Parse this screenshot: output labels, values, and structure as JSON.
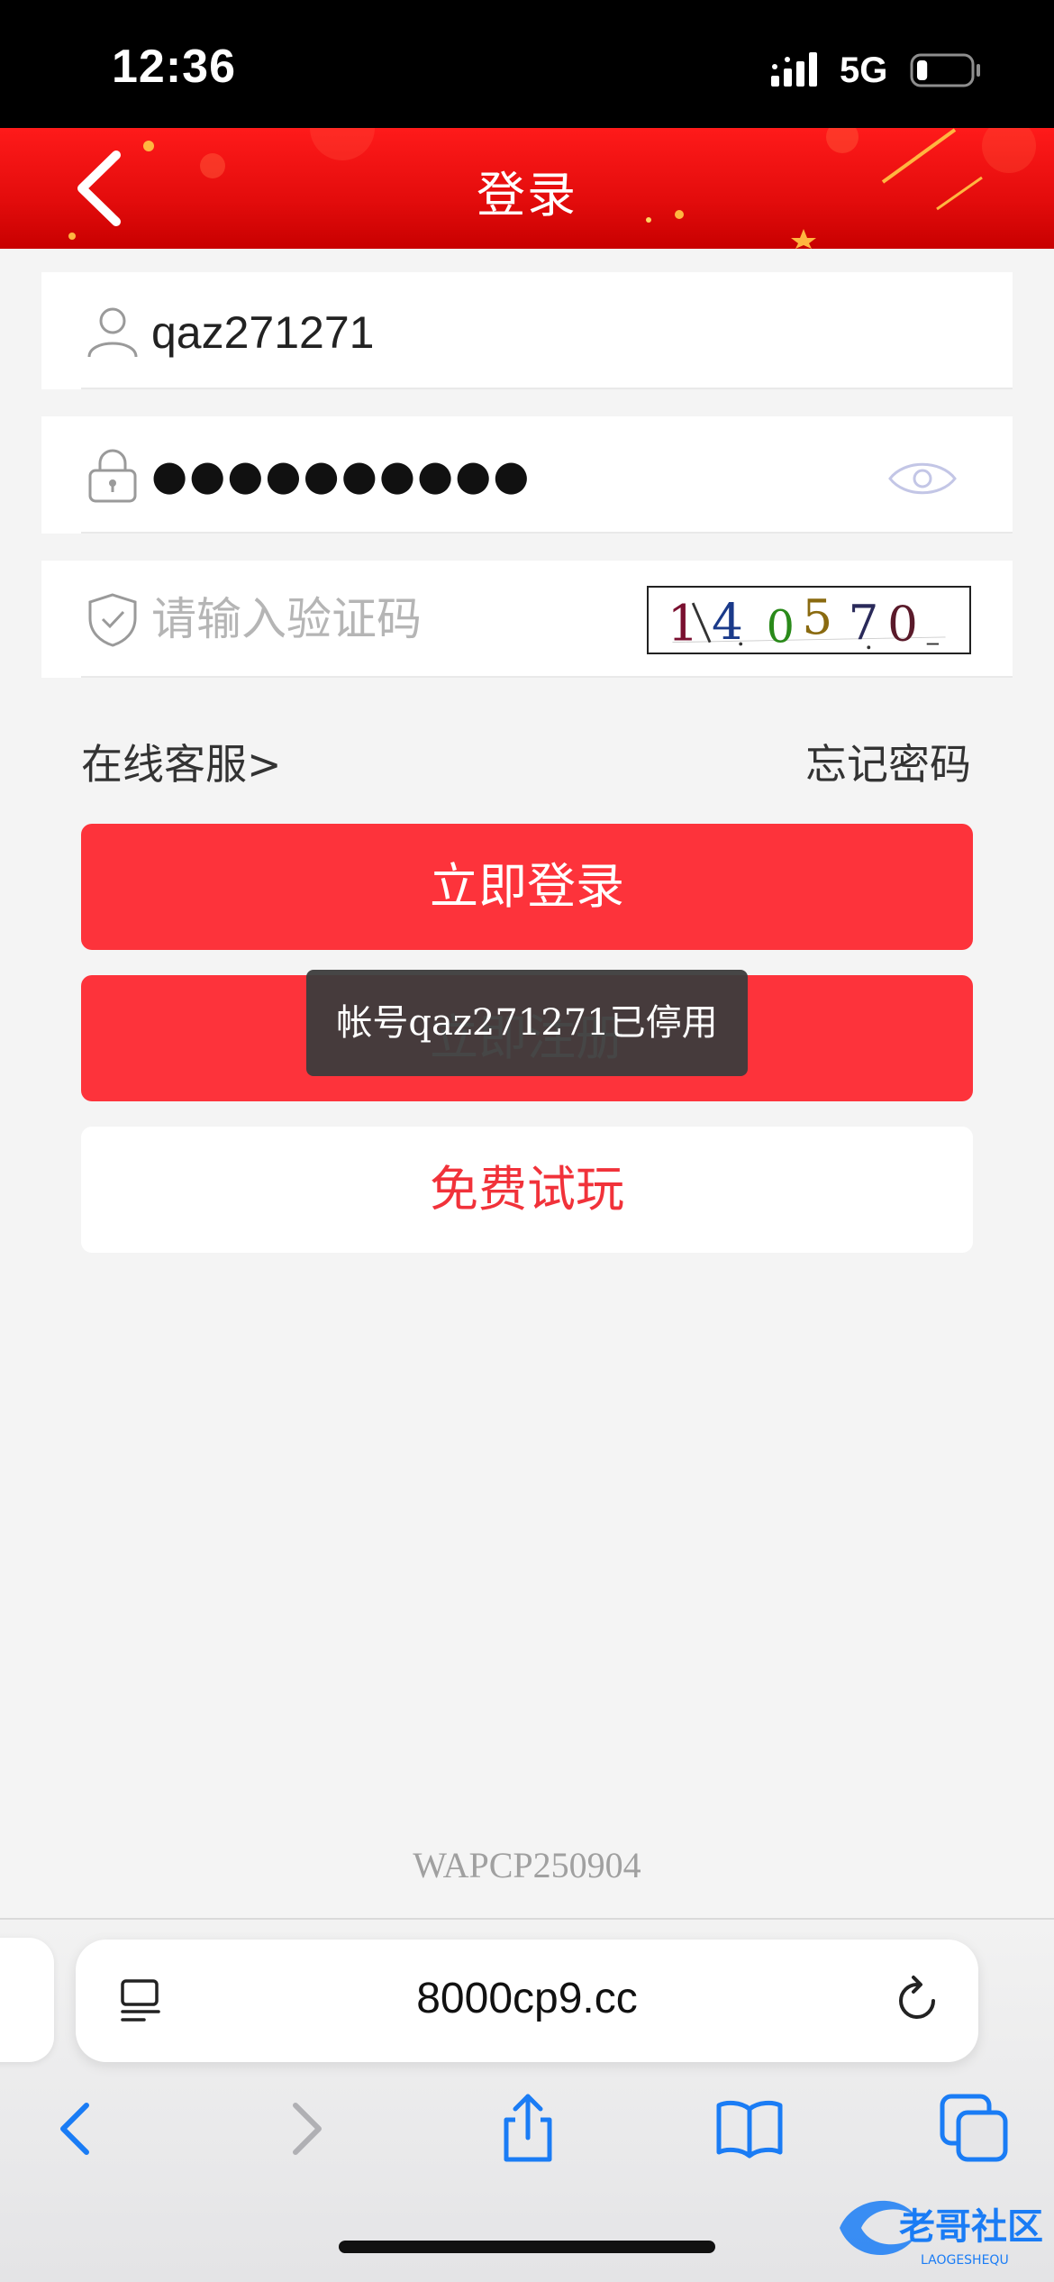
{
  "status_bar": {
    "time": "12:36",
    "network": "5G",
    "battery_level": 0.2
  },
  "header": {
    "title": "登录",
    "back_icon": "chevron-left-icon"
  },
  "form": {
    "username": {
      "icon": "user-icon",
      "value": "qaz271271"
    },
    "password": {
      "icon": "lock-icon",
      "value": "●●●●●●●●●●",
      "toggle_icon": "eye-icon"
    },
    "captcha": {
      "icon": "shield-check-icon",
      "placeholder": "请输入验证码",
      "image_text": "1405 70"
    }
  },
  "links": {
    "customer_service": "在线客服>",
    "forgot_password": "忘记密码"
  },
  "buttons": {
    "login": "立即登录",
    "register": "立即注册",
    "trial": "免费试玩"
  },
  "toast": {
    "message": "帐号qaz271271已停用"
  },
  "footer": {
    "version": "WAPCP250904"
  },
  "browser": {
    "url": "8000cp9.cc",
    "icons": [
      "reader-icon",
      "reload-icon",
      "back-icon",
      "forward-icon",
      "share-icon",
      "bookmarks-icon",
      "tabs-icon"
    ]
  },
  "watermark": {
    "text": "老哥社区",
    "subtext": "LAOGESHEQU"
  },
  "colors": {
    "header_red": "#e30c0c",
    "button_red": "#fd333b",
    "trial_text": "#f1323a",
    "ios_blue": "#1a7cf5"
  }
}
